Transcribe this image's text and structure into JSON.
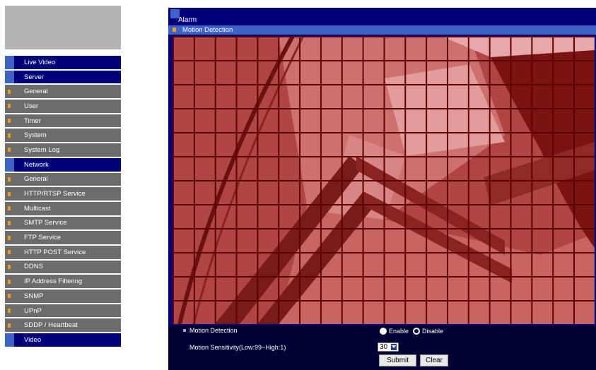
{
  "sidebar": {
    "items": [
      {
        "label": "Live Video",
        "kind": "section"
      },
      {
        "label": "Server",
        "kind": "section"
      },
      {
        "label": "General",
        "kind": "sub"
      },
      {
        "label": "User",
        "kind": "sub"
      },
      {
        "label": "Timer",
        "kind": "sub"
      },
      {
        "label": "System",
        "kind": "sub"
      },
      {
        "label": "System Log",
        "kind": "sub"
      },
      {
        "label": "Network",
        "kind": "section"
      },
      {
        "label": "General",
        "kind": "sub"
      },
      {
        "label": "HTTP/RTSP Service",
        "kind": "sub"
      },
      {
        "label": "Multicast",
        "kind": "sub"
      },
      {
        "label": "SMTP Service",
        "kind": "sub"
      },
      {
        "label": "FTP Service",
        "kind": "sub"
      },
      {
        "label": "HTTP POST Service",
        "kind": "sub"
      },
      {
        "label": "DDNS",
        "kind": "sub"
      },
      {
        "label": "IP Address Filtering",
        "kind": "sub"
      },
      {
        "label": "SNMP",
        "kind": "sub"
      },
      {
        "label": "UPnP",
        "kind": "sub"
      },
      {
        "label": "SDDP / Heartbeat",
        "kind": "sub"
      },
      {
        "label": "Video",
        "kind": "section"
      }
    ]
  },
  "main": {
    "title": "Alarm",
    "subtitle": "Motion Detection",
    "motion_detection_label": "Motion Detection",
    "enable_label": "Enable",
    "disable_label": "Disable",
    "selected_mode": "Disable",
    "sensitivity_label": "Motion Sensitivity(Low:99~High:1)",
    "sensitivity_value": "30",
    "submit_label": "Submit",
    "clear_label": "Clear"
  },
  "colors": {
    "nav_section": "#00007a",
    "nav_sub": "#6c6c6c",
    "accent_blue": "#3d63c9",
    "bullet_orange": "#f19b1c",
    "grid_red": "#a83a3a"
  },
  "icons": {
    "nav_section_marker": "blue-square-icon",
    "nav_sub_marker": "orange-bullet-icon"
  }
}
